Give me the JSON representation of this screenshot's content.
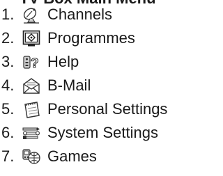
{
  "menu": {
    "heading": "TV Box Main Menu",
    "items": [
      {
        "number": "1.",
        "icon": "satellite-dish-icon",
        "label": "Channels"
      },
      {
        "number": "2.",
        "icon": "tv-screen-icon",
        "label": "Programmes"
      },
      {
        "number": "3.",
        "icon": "help-icon",
        "label": "Help"
      },
      {
        "number": "4.",
        "icon": "envelope-icon",
        "label": "B-Mail"
      },
      {
        "number": "5.",
        "icon": "notepad-icon",
        "label": "Personal Settings"
      },
      {
        "number": "6.",
        "icon": "tools-icon",
        "label": "System Settings"
      },
      {
        "number": "7.",
        "icon": "games-icon",
        "label": "Games"
      }
    ]
  }
}
